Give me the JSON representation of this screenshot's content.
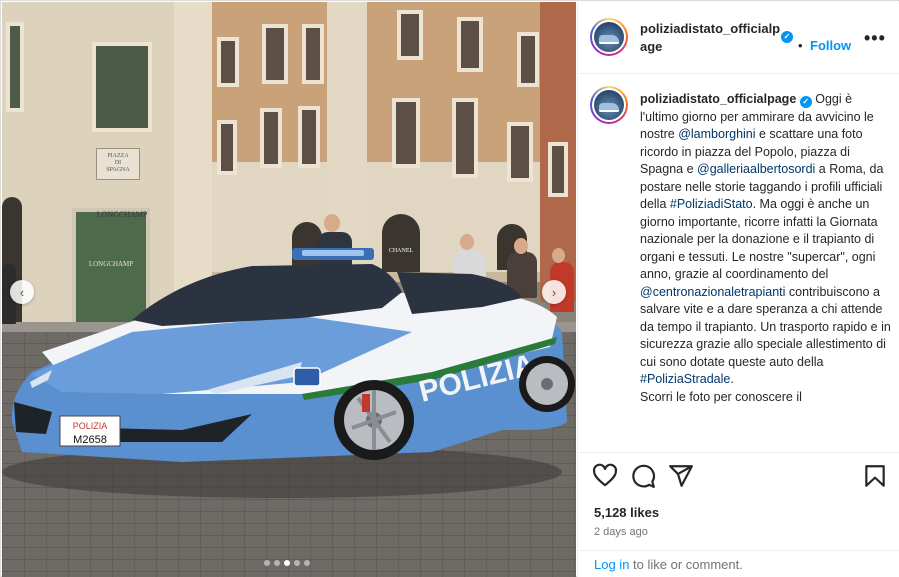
{
  "post": {
    "username": "poliziadistato_officialpage",
    "username_header": "poliziadistato_officialp age",
    "verified_mark": "✓",
    "dot_separator": "•",
    "follow_label": "Follow",
    "more_icon": "more-horizontal-icon",
    "more_glyph": "•••"
  },
  "photo": {
    "left_arrow": "‹",
    "right_arrow": "›",
    "plate_line1": "POLIZIA",
    "plate_line2": "M2658",
    "car_lettering": "POLIZIA",
    "sign_longchamp": "LONGCHAMP",
    "sign_longchamp_2": "LONGCHAMP",
    "sign_piazza": "PIAZZA\nDI\nSPAGNA",
    "sign_chanel": "CHANEL",
    "carousel_total": 5,
    "carousel_active": 3
  },
  "caption": {
    "segments": [
      {
        "t": "Oggi è l'ultimo giorno per ammirare da avvicino le nostre ",
        "k": "text"
      },
      {
        "t": "@lamborghini",
        "k": "link"
      },
      {
        "t": " e scattare una foto ricordo in piazza del Popolo, piazza di Spagna e ",
        "k": "text"
      },
      {
        "t": "@galleriaalbertosordi",
        "k": "link"
      },
      {
        "t": " a Roma, da postare nelle storie taggando i profili ufficiali della ",
        "k": "text"
      },
      {
        "t": "#PoliziadiStato",
        "k": "link"
      },
      {
        "t": ". Ma oggi è anche un giorno importante, ricorre infatti la Giornata nazionale per la donazione e il trapianto di organi e tessuti. Le nostre \"supercar\", ogni anno, grazie al coordinamento del ",
        "k": "text"
      },
      {
        "t": "@centronazionaletrapianti",
        "k": "link"
      },
      {
        "t": " contribuiscono a salvare vite e a dare speranza a chi attende da tempo il trapianto. Un trasporto rapido e in sicurezza grazie allo speciale allestimento di cui sono dotate queste auto della ",
        "k": "text"
      },
      {
        "t": "#PoliziaStradale",
        "k": "link"
      },
      {
        "t": ".\nScorri le foto per conoscere il",
        "k": "text"
      }
    ]
  },
  "actions": {
    "like_icon": "heart-icon",
    "comment_icon": "comment-icon",
    "share_icon": "share-icon",
    "save_icon": "bookmark-icon",
    "likes": "5,128 likes",
    "time_ago": "2 days ago"
  },
  "footer": {
    "login_label": "Log in",
    "rest": " to like or comment."
  },
  "colors": {
    "accent": "#0095f6",
    "link": "#00376b",
    "police_blue": "#5a8fd0",
    "police_white": "#f2f4f7"
  }
}
